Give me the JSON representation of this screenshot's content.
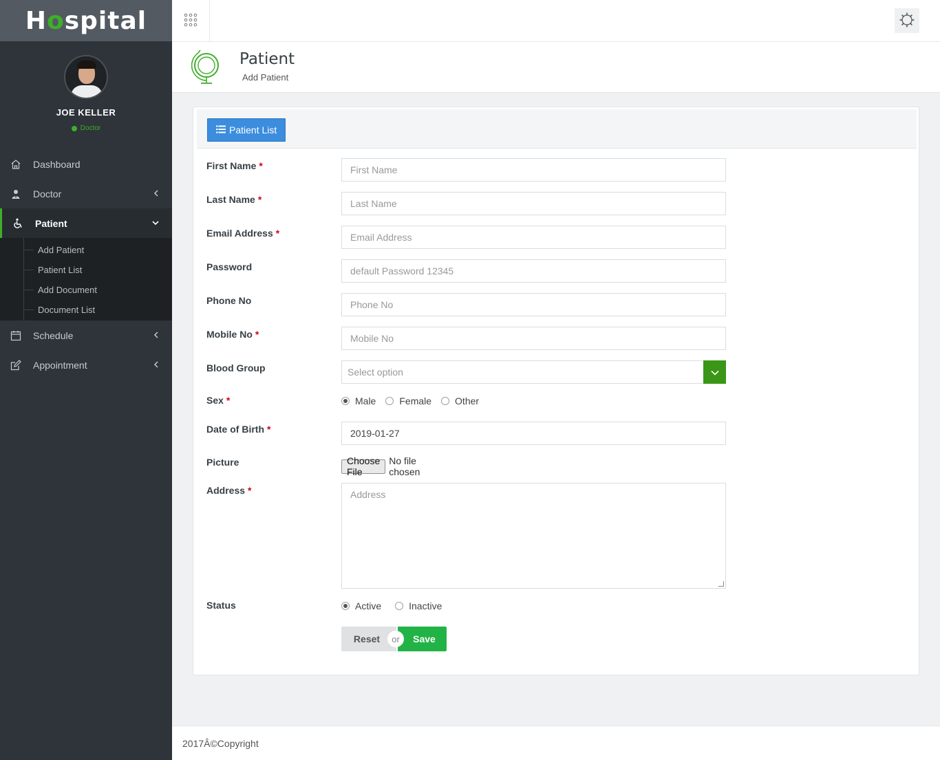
{
  "app": {
    "logo_prefix": "H",
    "logo_o": "o",
    "logo_suffix": "spital"
  },
  "profile": {
    "name": "JOE KELLER",
    "role": "Doctor"
  },
  "sidebar": {
    "items": [
      {
        "label": "Dashboard",
        "icon": "home-icon"
      },
      {
        "label": "Doctor",
        "icon": "doctor-icon"
      },
      {
        "label": "Patient",
        "icon": "wheelchair-icon"
      },
      {
        "label": "Schedule",
        "icon": "calendar-icon"
      },
      {
        "label": "Appointment",
        "icon": "edit-icon"
      }
    ],
    "patient_submenu": [
      "Add Patient",
      "Patient List",
      "Add Document",
      "Document List"
    ]
  },
  "header": {
    "title": "Patient",
    "subtitle": "Add Patient"
  },
  "panel": {
    "list_button": "Patient List"
  },
  "form": {
    "first_name": {
      "label": "First Name",
      "placeholder": "First Name",
      "required": "*"
    },
    "last_name": {
      "label": "Last Name",
      "placeholder": "Last Name",
      "required": "*"
    },
    "email": {
      "label": "Email Address",
      "placeholder": "Email Address",
      "required": "*"
    },
    "password": {
      "label": "Password",
      "placeholder": "default Password 12345"
    },
    "phone": {
      "label": "Phone No",
      "placeholder": "Phone No"
    },
    "mobile": {
      "label": "Mobile No",
      "placeholder": "Mobile No",
      "required": "*"
    },
    "blood_group": {
      "label": "Blood Group",
      "selected": "Select option"
    },
    "sex": {
      "label": "Sex",
      "required": "*",
      "options": [
        "Male",
        "Female",
        "Other"
      ],
      "selected": "Male"
    },
    "dob": {
      "label": "Date of Birth",
      "value": "2019-01-27",
      "required": "*"
    },
    "picture": {
      "label": "Picture",
      "button": "Choose File",
      "status": "No file chosen"
    },
    "address": {
      "label": "Address",
      "placeholder": "Address",
      "required": "*"
    },
    "status": {
      "label": "Status",
      "options": [
        "Active",
        "Inactive"
      ],
      "selected": "Active"
    },
    "reset": "Reset",
    "or": "or",
    "save": "Save"
  },
  "footer": {
    "text": "2017Â©Copyright"
  },
  "colors": {
    "sidebar_bg": "#2e3439",
    "accent_green": "#3fae2a",
    "primary_blue": "#3c8dde",
    "save_green": "#22b346"
  }
}
